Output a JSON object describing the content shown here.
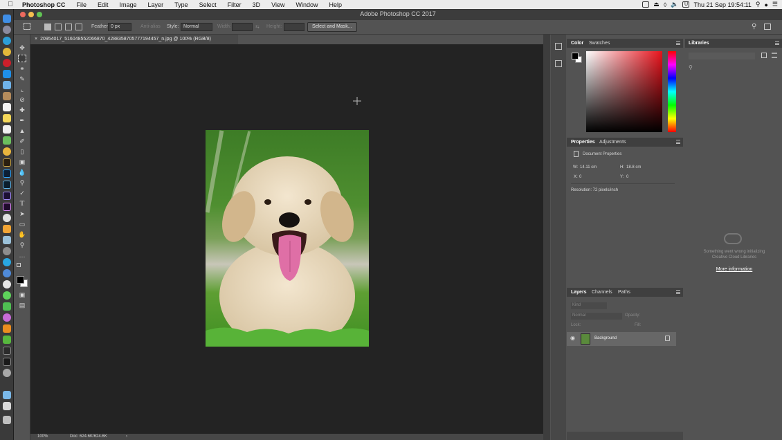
{
  "menubar": {
    "app_name": "Photoshop CC",
    "items": [
      "File",
      "Edit",
      "Image",
      "Layer",
      "Type",
      "Select",
      "Filter",
      "3D",
      "View",
      "Window",
      "Help"
    ],
    "clock": "Thu 21 Sep  19:54:11"
  },
  "window": {
    "title": "Adobe Photoshop CC 2017"
  },
  "options": {
    "feather_label": "Feather:",
    "feather_value": "0 px",
    "antialias_label": "Anti-alias",
    "style_label": "Style:",
    "style_value": "Normal",
    "width_label": "Width:",
    "height_label": "Height:",
    "select_mask_label": "Select and Mask..."
  },
  "document": {
    "tab_title": "20954017_516048552066870_4288358705777194457_n.jpg @ 100% (RGB/8)"
  },
  "statusbar": {
    "zoom": "100%",
    "doc": "Doc: 624.6K/624.6K"
  },
  "color_panel": {
    "tabs": [
      "Color",
      "Swatches"
    ]
  },
  "properties_panel": {
    "tabs": [
      "Properties",
      "Adjustments"
    ],
    "section": "Document Properties",
    "w_label": "W:",
    "w_value": "14.11 cm",
    "h_label": "H:",
    "h_value": "18.8 cm",
    "x_label": "X:",
    "x_value": "0",
    "y_label": "Y:",
    "y_value": "0",
    "resolution": "Resolution: 72 pixels/inch"
  },
  "layers_panel": {
    "tabs": [
      "Layers",
      "Channels",
      "Paths"
    ],
    "kind_placeholder": "Kind",
    "blend_mode": "Normal",
    "opacity_label": "Opacity:",
    "lock_label": "Lock:",
    "fill_label": "Fill:",
    "layers": [
      {
        "name": "Background"
      }
    ]
  },
  "libraries_panel": {
    "title": "Libraries",
    "message_line1": "Something went wrong initializing",
    "message_line2": "Creative Cloud Libraries",
    "link": "More information"
  },
  "colors": {
    "accent_foreground": "#000000",
    "accent_background": "#ffffff"
  }
}
